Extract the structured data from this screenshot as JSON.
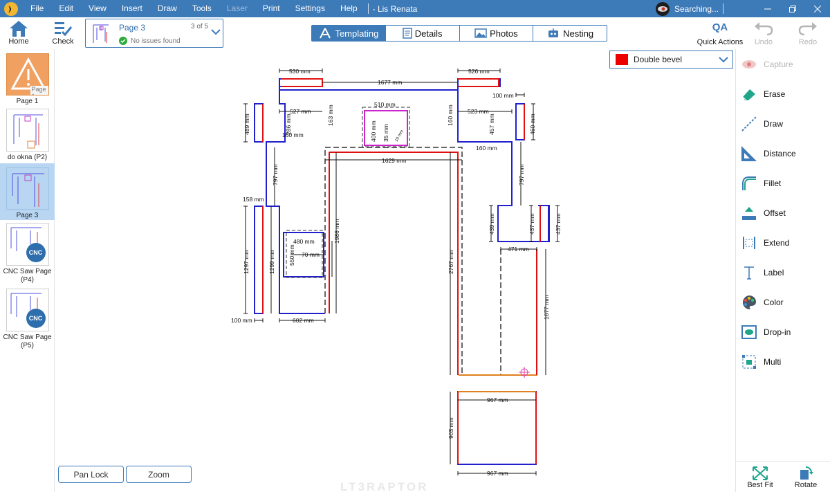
{
  "titlebar": {
    "menu": [
      "File",
      "Edit",
      "View",
      "Insert",
      "Draw",
      "Tools",
      "Laser",
      "Print",
      "Settings",
      "Help"
    ],
    "disabled_menu": "Laser",
    "document": "- Lis Renata",
    "search_text": "Searching..."
  },
  "toolbar": {
    "home": "Home",
    "check": "Check",
    "page_name": "Page 3",
    "page_count": "3 of 5",
    "page_status": "No issues found",
    "tabs": [
      "Templating",
      "Details",
      "Photos",
      "Nesting"
    ],
    "active_tab": "Templating",
    "quick_actions": "Quick Actions",
    "qa_badge": "QA",
    "undo": "Undo",
    "redo": "Redo"
  },
  "pages": [
    {
      "label": "Page 1",
      "overlay": "Page 1",
      "warning": true
    },
    {
      "label": "do okna (P2)"
    },
    {
      "label": "Page 3",
      "selected": true
    },
    {
      "label": "CNC Saw Page (P4)",
      "badge": "CNC"
    },
    {
      "label": "CNC Saw Page (P5)",
      "badge": "CNC"
    }
  ],
  "edge_profile": {
    "label": "Double bevel",
    "color": "#ee0000"
  },
  "tools": [
    {
      "label": "Capture",
      "icon": "capture-icon",
      "disabled": true
    },
    {
      "label": "Erase",
      "icon": "eraser-icon"
    },
    {
      "label": "Draw",
      "icon": "draw-line-icon"
    },
    {
      "label": "Distance",
      "icon": "ruler-triangle-icon"
    },
    {
      "label": "Fillet",
      "icon": "fillet-icon"
    },
    {
      "label": "Offset",
      "icon": "offset-icon"
    },
    {
      "label": "Extend",
      "icon": "extend-icon"
    },
    {
      "label": "Label",
      "icon": "text-label-icon"
    },
    {
      "label": "Color",
      "icon": "palette-icon"
    },
    {
      "label": "Drop-in",
      "icon": "drop-in-icon"
    },
    {
      "label": "Multi",
      "icon": "multi-select-icon"
    }
  ],
  "bottom": {
    "pan_lock": "Pan Lock",
    "zoom": "Zoom",
    "best_fit": "Best Fit",
    "rotate": "Rotate",
    "brand": "LT3RAPTOR"
  },
  "dimensions": {
    "d530": "530 mm",
    "d1677top": "1677 mm",
    "d526": "526 mm",
    "d100top": "100 mm",
    "d489": "489 mm",
    "d527": "527 mm",
    "d286": "286 mm",
    "d160a": "160 mm",
    "d163": "163 mm",
    "d510": "510 mm",
    "d400": "400 mm",
    "d35": "35 mm",
    "d10": "10 mm",
    "d160b": "160 mm",
    "d523": "523 mm",
    "d457": "457 mm",
    "d460": "460 mm",
    "d160c": "160 mm",
    "d1629": "1629 mm",
    "d797a": "797 mm",
    "d797b": "797 mm",
    "d158": "158 mm",
    "d439": "439 mm",
    "d437a": "437 mm",
    "d437b": "437 mm",
    "d480": "480 mm",
    "d70": "70 mm",
    "d550": "550 mm",
    "d1986": "1986 mm",
    "d471": "471 mm",
    "d1297": "1297 mm",
    "d1299": "1299 mm",
    "d2767": "2767 mm",
    "d1677r": "1677 mm",
    "d100b": "100 mm",
    "d602": "602 mm",
    "d967a": "967 mm",
    "d903": "903 mm",
    "d967b": "967 mm"
  }
}
